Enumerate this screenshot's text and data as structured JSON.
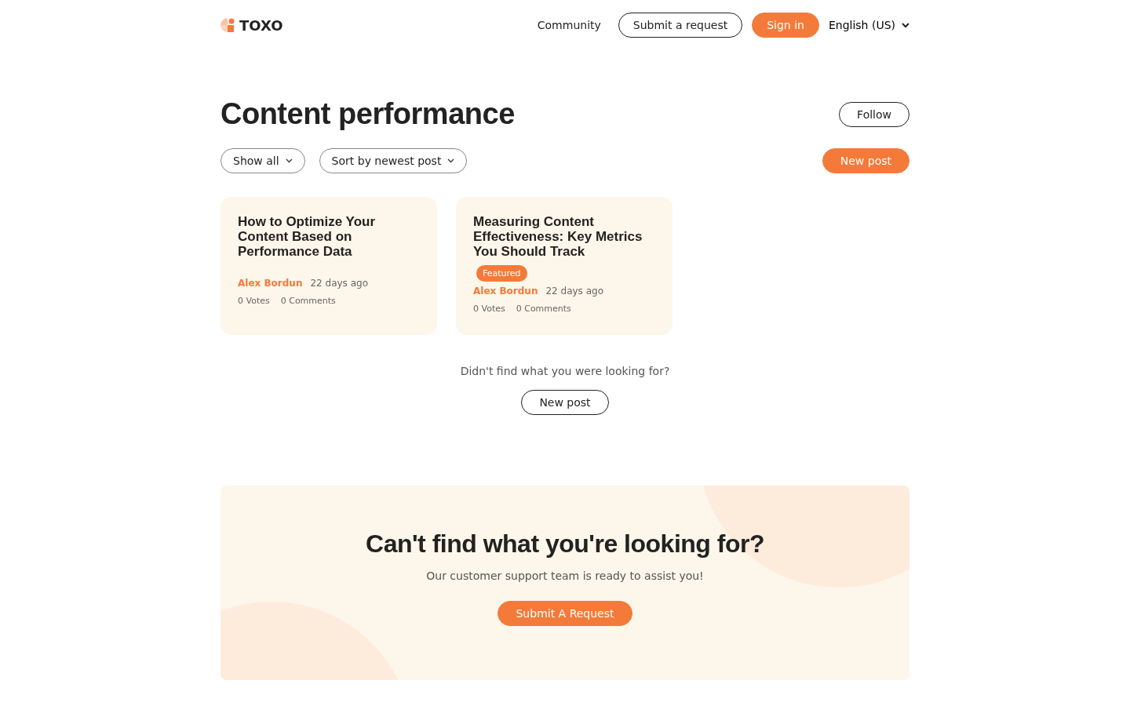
{
  "header": {
    "logo": "TOXO",
    "nav": [
      {
        "label": "Community",
        "kind": "link"
      },
      {
        "label": "Submit a request",
        "kind": "outline"
      },
      {
        "label": "Sign in",
        "kind": "primary"
      }
    ],
    "language": "English (US)"
  },
  "title": "Content performance",
  "follow": "Follow",
  "filters": [
    "Show all",
    "Sort by newest post"
  ],
  "new_post": "New post",
  "posts": [
    {
      "title": "How to Optimize Your Content Based on Performance Data",
      "featured": false,
      "author": "Alex Bordun",
      "time": "22 days ago",
      "votes": "0 Votes",
      "comments": "0 Comments"
    },
    {
      "title": "Measuring Content Effectiveness: Key Metrics You Should Track",
      "featured": true,
      "badge": "Featured",
      "author": "Alex Bordun",
      "time": "22 days ago",
      "votes": "0 Votes",
      "comments": "0 Comments"
    }
  ],
  "not_found": {
    "text": "Didn't find what you were looking for?",
    "button": "New post"
  },
  "cta": {
    "title": "Can't find what you're looking for?",
    "subtitle": "Our customer support team is ready to assist you!",
    "button": "Submit A Request"
  }
}
